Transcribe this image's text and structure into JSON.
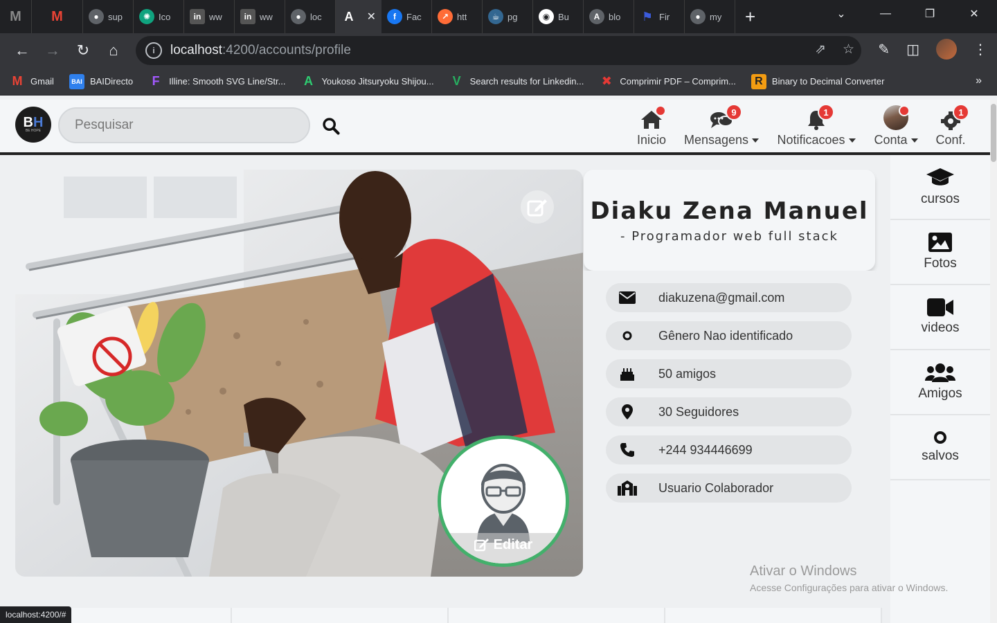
{
  "browser": {
    "tabs": [
      {
        "title": "",
        "icon": "gmail-m-icon",
        "color": "#888888"
      },
      {
        "title": "",
        "icon": "gmail-icon",
        "color": "#ea4335"
      },
      {
        "title": "sup",
        "icon": "globe-icon",
        "color": "#5f6368"
      },
      {
        "title": "Ico",
        "icon": "openai-icon",
        "color": "#10a37f"
      },
      {
        "title": "ww",
        "icon": "linkedin-icon",
        "color": "#0a66c2"
      },
      {
        "title": "ww",
        "icon": "linkedin-icon",
        "color": "#0a66c2"
      },
      {
        "title": "loc",
        "icon": "globe-icon",
        "color": "#5f6368"
      },
      {
        "title": "",
        "icon": "angular-icon",
        "color": "#202124",
        "active": true
      },
      {
        "title": "Fac",
        "icon": "facebook-icon",
        "color": "#1877f2"
      },
      {
        "title": "htt",
        "icon": "postman-icon",
        "color": "#ff6c37"
      },
      {
        "title": "pg",
        "icon": "postgres-icon",
        "color": "#336791"
      },
      {
        "title": "Bu",
        "icon": "github-icon",
        "color": "#ffffff"
      },
      {
        "title": "blo",
        "icon": "angular-icon",
        "color": "#5f6368"
      },
      {
        "title": "Fir",
        "icon": "flag-icon",
        "color": "#3b5bdb"
      },
      {
        "title": "my",
        "icon": "globe-icon",
        "color": "#5f6368"
      }
    ],
    "url": {
      "host": "localhost",
      "path": ":4200/accounts/profile"
    },
    "bookmarks": [
      {
        "label": "Gmail",
        "icon": "gmail-icon",
        "color": "#ea4335"
      },
      {
        "label": "BAIDirecto",
        "icon": "bai-icon",
        "color": "#2f80ed"
      },
      {
        "label": "Illine: Smooth SVG Line/Str...",
        "icon": "figma-icon",
        "color": "#a259ff"
      },
      {
        "label": "Youkoso Jitsuryoku Shijou...",
        "icon": "anime-icon",
        "color": "#2ecc71"
      },
      {
        "label": "Search results for Linkedin...",
        "icon": "vuetify-icon",
        "color": "#27ae60"
      },
      {
        "label": "Comprimir PDF – Comprim...",
        "icon": "ilovepdf-icon",
        "color": "#e53935"
      },
      {
        "label": "Binary to Decimal Converter",
        "icon": "rapidtables-icon",
        "color": "#f39c12"
      }
    ],
    "status_url": "localhost:4200/#"
  },
  "app": {
    "logo": {
      "text_b": "B",
      "text_h": "H",
      "sub": "BE HOPE"
    },
    "search": {
      "placeholder": "Pesquisar"
    },
    "menu": [
      {
        "label": "Inicio",
        "icon": "home-icon",
        "badge": "",
        "dot": true,
        "caret": false
      },
      {
        "label": "Mensagens",
        "icon": "chat-icon",
        "badge": "9",
        "dot": false,
        "caret": true
      },
      {
        "label": "Notificacoes",
        "icon": "bell-icon",
        "badge": "1",
        "dot": false,
        "caret": true
      },
      {
        "label": "Conta",
        "icon": "user-avatar-icon",
        "badge": "",
        "dot": true,
        "caret": true
      },
      {
        "label": "Conf.",
        "icon": "gear-icon",
        "badge": "1",
        "dot": false,
        "caret": false
      }
    ]
  },
  "profile": {
    "name": "Diaku Zena Manuel",
    "role": "- Programador web full stack",
    "avatar_edit_label": "Editar",
    "info": [
      {
        "icon": "envelope-icon",
        "text": "diakuzena@gmail.com"
      },
      {
        "icon": "circle-icon",
        "text": "Gênero Nao identificado"
      },
      {
        "icon": "birthday-cake-icon",
        "text": "50 amigos"
      },
      {
        "icon": "map-marker-icon",
        "text": "30 Seguidores"
      },
      {
        "icon": "phone-icon",
        "text": "+244 934446699"
      },
      {
        "icon": "school-icon",
        "text": "Usuario Colaborador"
      }
    ]
  },
  "side_nav": [
    {
      "label": "cursos",
      "icon": "graduation-cap-icon"
    },
    {
      "label": "Fotos",
      "icon": "image-icon"
    },
    {
      "label": "videos",
      "icon": "video-icon"
    },
    {
      "label": "Amigos",
      "icon": "users-icon"
    },
    {
      "label": "salvos",
      "icon": "circle-icon"
    }
  ],
  "watermark": {
    "title": "Ativar o Windows",
    "subtitle": "Acesse Configurações para ativar o Windows."
  }
}
